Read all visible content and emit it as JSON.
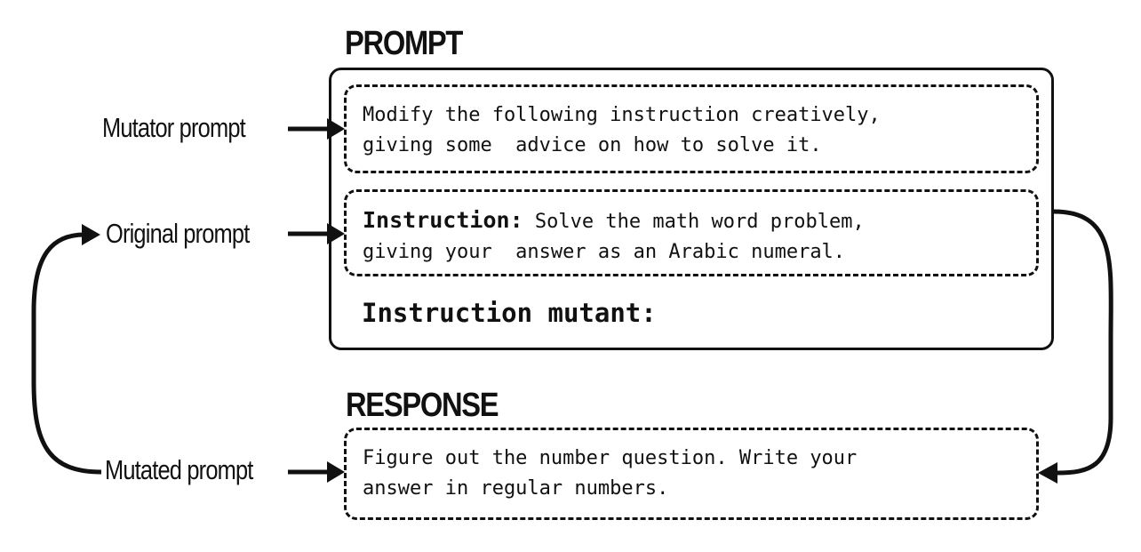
{
  "headings": {
    "prompt": "PROMPT",
    "response": "RESPONSE"
  },
  "side_labels": {
    "mutator": "Mutator prompt",
    "original": "Original prompt",
    "mutated": "Mutated prompt"
  },
  "prompt_box": {
    "mutator_line1": "Modify the following instruction creatively,",
    "mutator_line2": "giving some  advice on how to solve it.",
    "instruction_label": "Instruction:",
    "instruction_line1": " Solve the math word problem,",
    "instruction_line2": "giving your  answer as an Arabic numeral.",
    "mutant_label": "Instruction mutant:"
  },
  "response_box": {
    "line1": "Figure out the number question. Write your",
    "line2": "answer in regular numbers."
  }
}
